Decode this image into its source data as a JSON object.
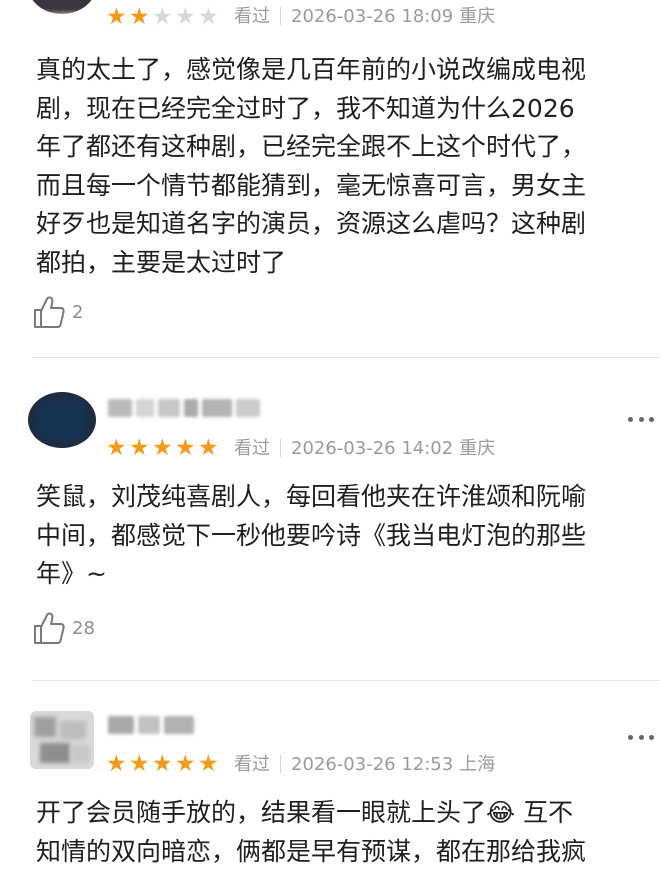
{
  "reviews": [
    {
      "rating": 2,
      "max_rating": 5,
      "status": "看过",
      "date": "2026-03-26 18:09",
      "location": "重庆",
      "lines": [
        "真的太土了，感觉像是几百年前的小说改编成电视",
        "剧，现在已经完全过时了，我不知道为什么2026",
        "年了都还有这种剧，已经完全跟不上这个时代了，",
        "而且每一个情节都能猜到，毫无惊喜可言，男女主",
        "好歹也是知道名字的演员，资源这么虐吗？这种剧",
        "都拍，主要是太过时了"
      ],
      "likes": "2"
    },
    {
      "rating": 5,
      "max_rating": 5,
      "status": "看过",
      "date": "2026-03-26 14:02",
      "location": "重庆",
      "lines": [
        "笑鼠，刘茂纯喜剧人，每回看他夹在许淮颂和阮喻",
        "中间，都感觉下一秒他要吟诗《我当电灯泡的那些",
        "年》~"
      ],
      "likes": "28"
    },
    {
      "rating": 5,
      "max_rating": 5,
      "status": "看过",
      "date": "2026-03-26 12:53",
      "location": "上海",
      "lines": [
        "开了会员随手放的，结果看一眼就上头了😂 互不",
        "知情的双向暗恋，俩都是早有预谋，都在那给我疯"
      ],
      "likes": ""
    }
  ],
  "icons": {
    "star": "star-icon",
    "like": "thumbs-up-icon",
    "more": "more-dots-icon"
  },
  "colors": {
    "star_on": "#f49b1a",
    "star_off": "#d7d7d7",
    "meta_text": "#9b9b9b",
    "body_text": "#1f1f1f"
  }
}
